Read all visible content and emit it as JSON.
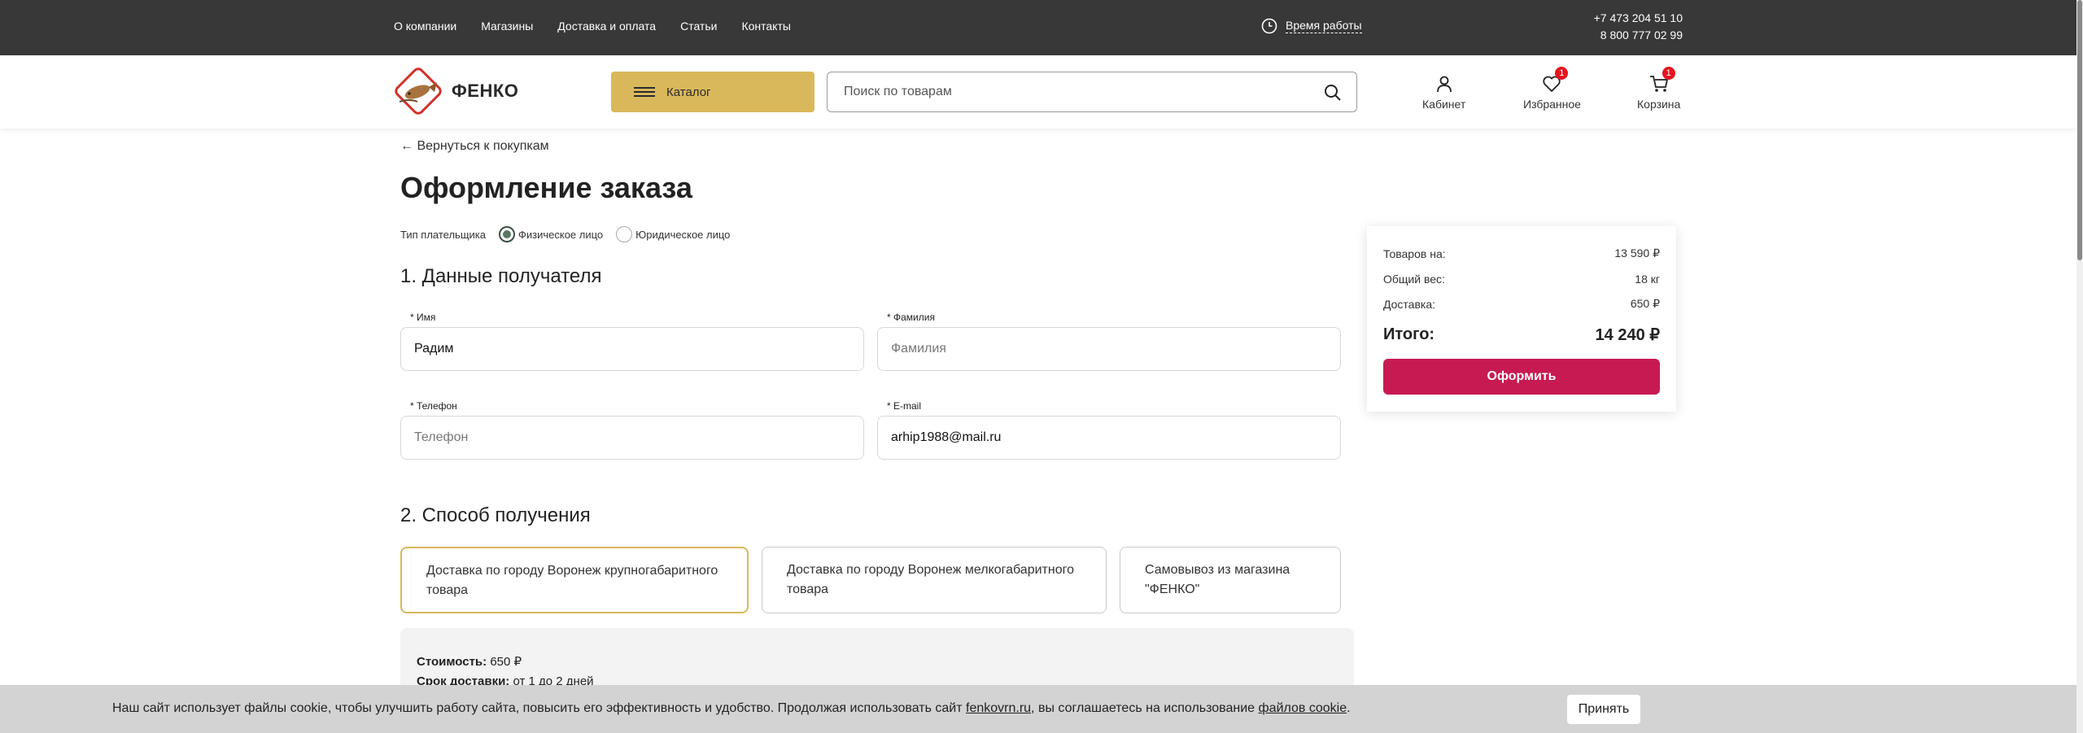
{
  "topbar": {
    "nav": [
      "О компании",
      "Магазины",
      "Доставка и оплата",
      "Статьи",
      "Контакты"
    ],
    "worktime_label": "Время работы",
    "phone1": "+7 473 204 51 10",
    "phone2": "8 800 777 02 99"
  },
  "header": {
    "logo_text": "ФЕНКО",
    "catalog_label": "Каталог",
    "search_placeholder": "Поиск по товарам",
    "cabinet_label": "Кабинет",
    "favorites_label": "Избранное",
    "favorites_count": "1",
    "cart_label": "Корзина",
    "cart_count": "1"
  },
  "main": {
    "back_link": "← Вернуться к покупкам",
    "title": "Оформление заказа",
    "payer_type_label": "Тип плательщика",
    "payer_options": [
      "Физическое лицо",
      "Юридическое лицо"
    ],
    "payer_selected": "Физическое лицо",
    "section1_title": "1. Данные получателя",
    "fields": {
      "name_label": "* Имя",
      "name_value": "Радим",
      "surname_label": "* Фамилия",
      "surname_placeholder": "Фамилия",
      "phone_label": "* Телефон",
      "phone_placeholder": "Телефон",
      "email_label": "* E-mail",
      "email_value": "arhip1988@mail.ru"
    },
    "section2_title": "2. Способ получения",
    "delivery_options": [
      "Доставка по городу Воронеж крупногабаритного товара",
      "Доставка по городу Воронеж мелкогабаритного товара",
      "Самовывоз из магазина \"ФЕНКО\""
    ],
    "delivery_selected_index": 0,
    "delivery_info": {
      "cost_label": "Стоимость:",
      "cost_value": "650 ₽",
      "term_label": "Срок доставки:",
      "term_value": "от 1 до 2 дней"
    }
  },
  "summary": {
    "goods_label": "Товаров на:",
    "goods_value": "13 590 ₽",
    "weight_label": "Общий вес:",
    "weight_value": "18 кг",
    "delivery_label": "Доставка:",
    "delivery_value": "650 ₽",
    "total_label": "Итого:",
    "total_value": "14 240 ₽",
    "submit_label": "Оформить"
  },
  "cookie": {
    "text_before": "Наш сайт использует файлы cookie, чтобы улучшить работу сайта, повысить его эффективность и удобство. Продолжая использовать сайт ",
    "site_link": "fenkovrn.ru",
    "text_middle": ", вы соглашаетесь на использование ",
    "cookie_link": "файлов cookie",
    "text_after": ".",
    "accept_label": "Принять"
  },
  "colors": {
    "topbar": "#383838",
    "catalog": "#d9b85c",
    "submit": "#c81a52",
    "badge": "#e3151f",
    "selected_border": "#d9b85c"
  }
}
